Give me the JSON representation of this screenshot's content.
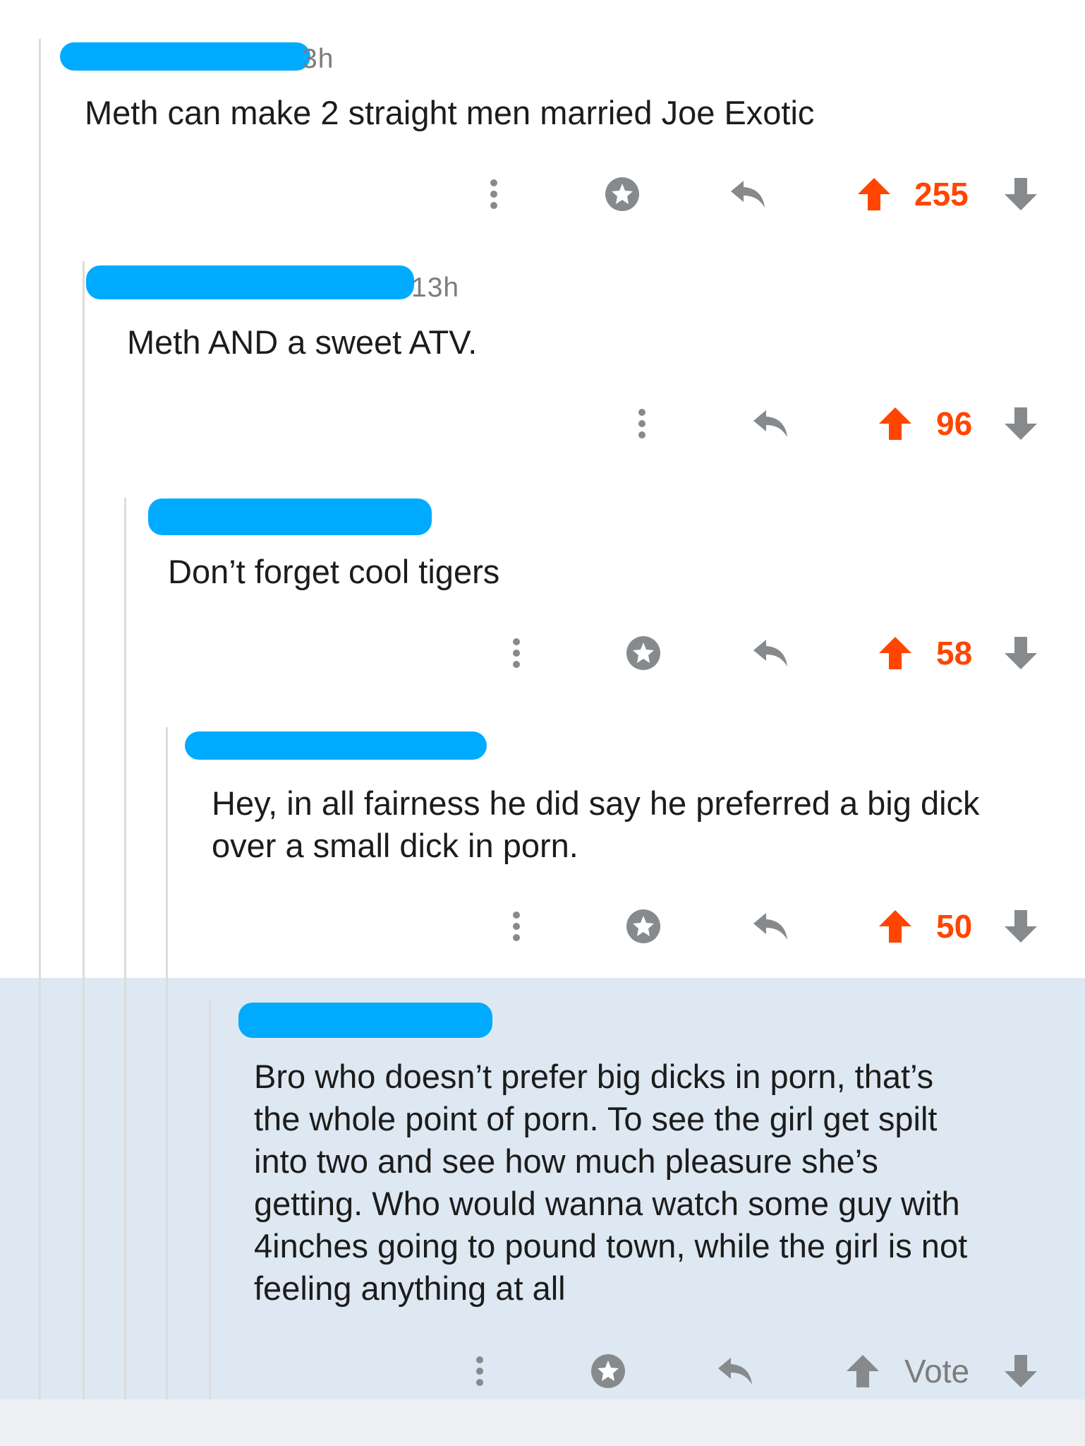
{
  "colors": {
    "upvoted": "#ff4500",
    "icon_gray": "#878a8c",
    "thread_line": "#dcdcdc",
    "highlight_bg": "#dde8f2",
    "redaction": "#00aaff"
  },
  "comments": [
    {
      "age": "3h",
      "body": [
        "Meth can make 2 straight men married Joe Exotic"
      ],
      "score": "255",
      "upvoted": true,
      "has_award": true,
      "icons": [
        "more-vertical-icon",
        "award-icon",
        "reply-icon",
        "upvote-icon",
        "downvote-icon"
      ]
    },
    {
      "age": "13h",
      "body": [
        "Meth AND a sweet ATV."
      ],
      "score": "96",
      "upvoted": true,
      "has_award": false,
      "icons": [
        "more-vertical-icon",
        "reply-icon",
        "upvote-icon",
        "downvote-icon"
      ]
    },
    {
      "age": "",
      "body": [
        "Don’t forget cool tigers"
      ],
      "score": "58",
      "upvoted": true,
      "has_award": true,
      "icons": [
        "more-vertical-icon",
        "award-icon",
        "reply-icon",
        "upvote-icon",
        "downvote-icon"
      ]
    },
    {
      "age": "",
      "body": [
        "Hey, in all fairness he did say he preferred a big dick",
        "over a small dick in porn."
      ],
      "score": "50",
      "upvoted": true,
      "has_award": true,
      "icons": [
        "more-vertical-icon",
        "award-icon",
        "reply-icon",
        "upvote-icon",
        "downvote-icon"
      ]
    },
    {
      "age": "",
      "body": [
        "Bro who doesn’t prefer big dicks in porn, that’s",
        "the whole point of porn. To see the girl get spilt",
        "into two and see how much pleasure she’s",
        "getting. Who would wanna watch some guy with",
        "4inches going to pound town, while the girl is not",
        "feeling anything at all"
      ],
      "score": "Vote",
      "upvoted": false,
      "has_award": true,
      "icons": [
        "more-vertical-icon",
        "award-icon",
        "reply-icon",
        "upvote-icon",
        "downvote-icon"
      ]
    }
  ]
}
